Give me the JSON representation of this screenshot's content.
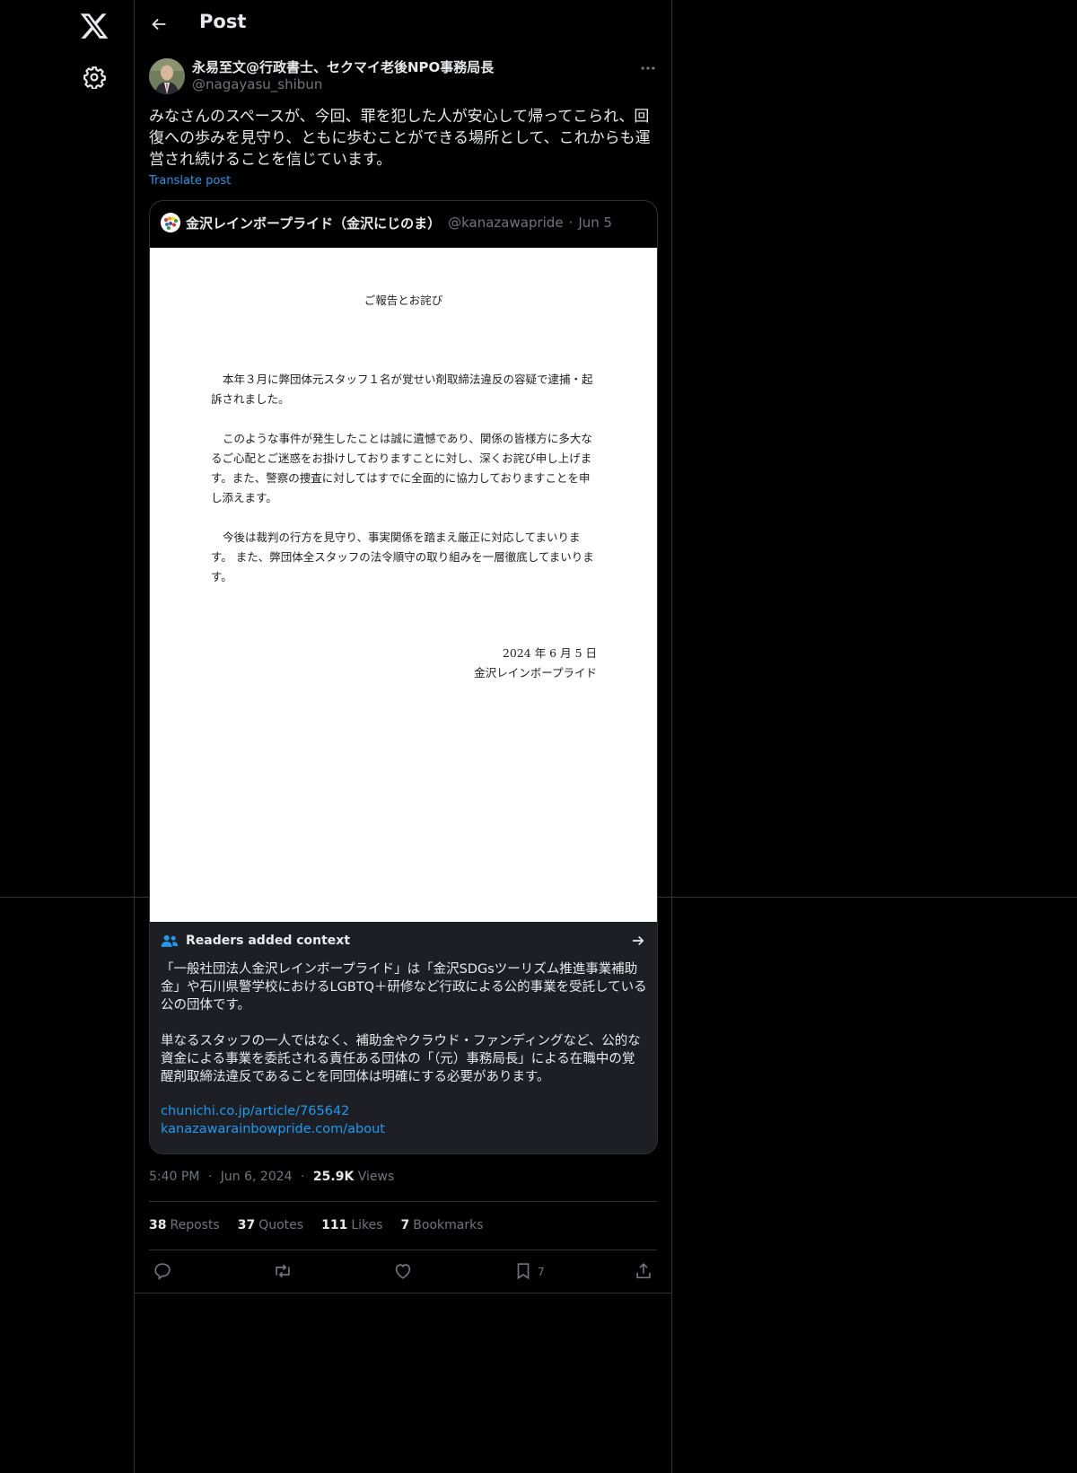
{
  "header": {
    "title": "Post"
  },
  "author": {
    "name": "永易至文@行政書士、セクマイ老後NPO事務局長",
    "handle": "@nagayasu_shibun"
  },
  "post": {
    "text": "みなさんのスペースが、今回、罪を犯した人が安心して帰ってこられ、回復への歩みを見守り、ともに歩むことができる場所として、これからも運営され続けることを信じています。",
    "translate_label": "Translate post"
  },
  "quote": {
    "name": "金沢レインボープライド（金沢にじのま）",
    "handle": "@kanazawapride",
    "separator": "·",
    "date": "Jun 5"
  },
  "document": {
    "title": "ご報告とお詫び",
    "p1": "本年３月に弊団体元スタッフ１名が覚せい剤取締法違反の容疑で逮捕・起訴されました。",
    "p2": "このような事件が発生したことは誠に遺憾であり、関係の皆様方に多大なるご心配とご迷惑をお掛けしておりますことに対し、深くお詫び申し上げます。また、警察の捜査に対してはすでに全面的に協力しておりますことを申し添えます。",
    "p3": "今後は裁判の行方を見守り、事実関係を踏まえ厳正に対応してまいります。 また、弊団体全スタッフの法令順守の取り組みを一層徹底してまいります。",
    "date": "2024 年 6 月 5 日",
    "signature": "金沢レインボープライド"
  },
  "context": {
    "title": "Readers added context",
    "p1": "「一般社団法人金沢レインボープライド」は「金沢SDGsツーリズム推進事業補助金」や石川県警学校におけるLGBTQ＋研修など行政による公的事業を受託している公の団体です。",
    "p2": "単なるスタッフの一人ではなく、補助金やクラウド・ファンディングなど、公的な資金による事業を委託される責任ある団体の「（元）事務局長」による在職中の覚醒剤取締法違反であることを同団体は明確にする必要があります。",
    "link1": "chunichi.co.jp/article/765642",
    "link2": "kanazawarainbowpride.com/about"
  },
  "meta": {
    "time": "5:40 PM",
    "dot": "·",
    "date": "Jun 6, 2024",
    "views_count": "25.9K",
    "views_label": "Views"
  },
  "stats": {
    "reposts_count": "38",
    "reposts_label": "Reposts",
    "quotes_count": "37",
    "quotes_label": "Quotes",
    "likes_count": "111",
    "likes_label": "Likes",
    "bookmarks_count": "7",
    "bookmarks_label": "Bookmarks"
  },
  "actions": {
    "bookmark_count": "7"
  },
  "icons": {
    "nav": [
      "x-logo-icon",
      "gear-icon"
    ],
    "header": [
      "back-arrow-icon"
    ],
    "post": [
      "more-icon"
    ],
    "context": [
      "people-icon",
      "arrow-right-icon"
    ],
    "actions": [
      "reply-icon",
      "repost-icon",
      "like-icon",
      "bookmark-icon",
      "share-icon"
    ]
  },
  "colors": {
    "accent": "#1d9bf0",
    "background": "#000000",
    "border": "#2f3336",
    "muted": "#71767b"
  }
}
